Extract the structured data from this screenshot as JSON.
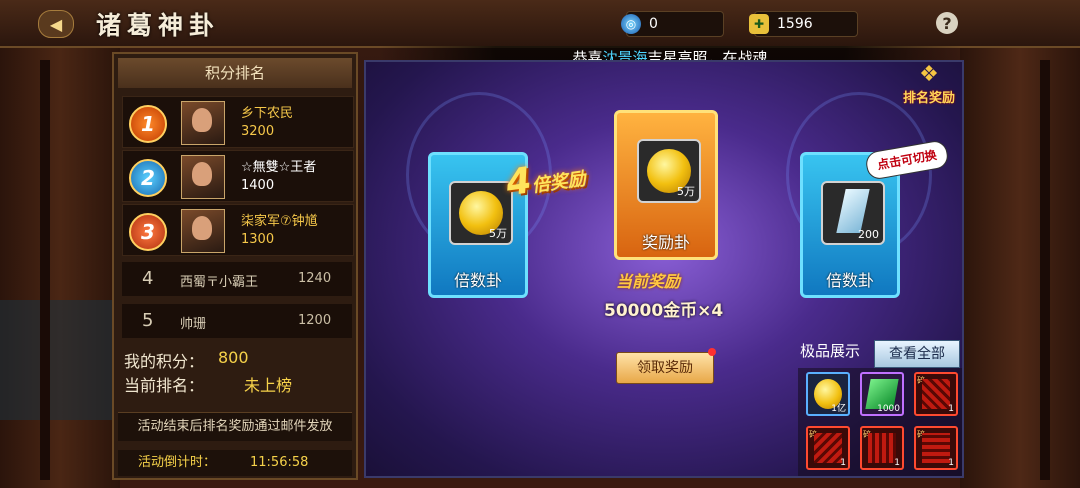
{
  "header": {
    "title": "诸葛神卦",
    "currency_a": "0",
    "currency_b": "1596",
    "help": "?"
  },
  "announcement": {
    "prefix": "恭喜",
    "name": "沈景海",
    "suffix": "吉星高照，在战魂"
  },
  "leaderboard": {
    "title": "积分排名",
    "top": [
      {
        "rank": "1",
        "name": "乡下农民",
        "score": "3200",
        "name_color": "#f6c84a",
        "score_color": "#f6c84a"
      },
      {
        "rank": "2",
        "name": "☆無雙☆王者",
        "score": "1400",
        "name_color": "#ffffff",
        "score_color": "#ffffff"
      },
      {
        "rank": "3",
        "name": "柒家军⑦钟馗",
        "score": "1300",
        "name_color": "#f6c84a",
        "score_color": "#f6c84a"
      }
    ],
    "others": [
      {
        "rank": "4",
        "name": "西蜀〒小霸王",
        "score": "1240"
      },
      {
        "rank": "5",
        "name": "帅珊",
        "score": "1200"
      }
    ],
    "my_score_label": "我的积分：",
    "my_score": "800",
    "my_rank_label": "当前排名：",
    "my_rank": "未上榜",
    "notice": "活动结束后排名奖励通过邮件发放",
    "countdown_label": "活动倒计时：",
    "countdown": "11:56:58"
  },
  "main": {
    "rank_reward_label": "排名奖励",
    "multiplier": "4",
    "multiplier_suffix": "倍奖励",
    "tip": "点击可切换",
    "cards": [
      {
        "label": "倍数卦",
        "qty": "5万",
        "item": "coin"
      },
      {
        "label": "奖励卦",
        "qty": "5万",
        "item": "coin"
      },
      {
        "label": "倍数卦",
        "qty": "200",
        "item": "crystal"
      }
    ],
    "current_reward_label": "当前奖励",
    "current_reward": "50000金币×4",
    "claim_button": "领取奖励"
  },
  "premium": {
    "title": "极品展示",
    "view_all": "查看全部",
    "items": [
      {
        "kind": "coin-icon",
        "qty": "1亿",
        "border": "blue"
      },
      {
        "kind": "emerald-icon",
        "qty": "1000",
        "border": "purple"
      },
      {
        "kind": "red-token-icon",
        "qty": "1",
        "border": "red",
        "tag": "碎"
      },
      {
        "kind": "red-token-icon",
        "qty": "1",
        "border": "red",
        "tag": "碎"
      },
      {
        "kind": "red-token-icon",
        "qty": "1",
        "border": "red",
        "tag": "碎"
      },
      {
        "kind": "red-token-icon",
        "qty": "1",
        "border": "red",
        "tag": "碎"
      }
    ]
  }
}
